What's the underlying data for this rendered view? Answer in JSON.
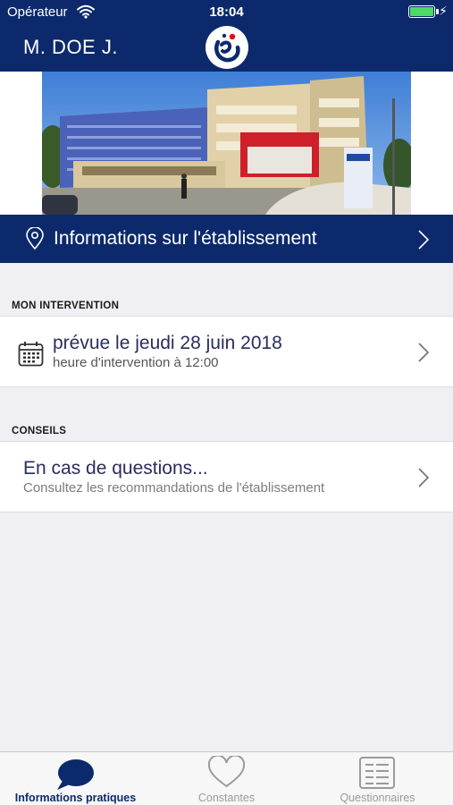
{
  "status_bar": {
    "carrier": "Opérateur",
    "time": "18:04",
    "charging_symbol": "⚡"
  },
  "header": {
    "user_name": "M. DOE J.",
    "logo_icon": "hospital-logo-icon"
  },
  "establishment": {
    "label": "Informations sur l'établissement",
    "icon": "location-pin-icon"
  },
  "intervention": {
    "section_title": "MON INTERVENTION",
    "title": "prévue le jeudi 28 juin 2018",
    "subtitle": "heure d'intervention à 12:00",
    "icon": "calendar-icon"
  },
  "advice": {
    "section_title": "CONSEILS",
    "title": "En cas de questions...",
    "subtitle": "Consultez les recommandations de l'établissement"
  },
  "tabs": [
    {
      "label": "Informations pratiques",
      "icon": "speech-bubble-icon",
      "active": true
    },
    {
      "label": "Constantes",
      "icon": "heart-icon",
      "active": false
    },
    {
      "label": "Questionnaires",
      "icon": "form-icon",
      "active": false
    }
  ],
  "colors": {
    "brand_navy": "#0c2a6b",
    "background": "#efeff4",
    "battery": "#4cd964",
    "logo_red": "#e30613"
  }
}
